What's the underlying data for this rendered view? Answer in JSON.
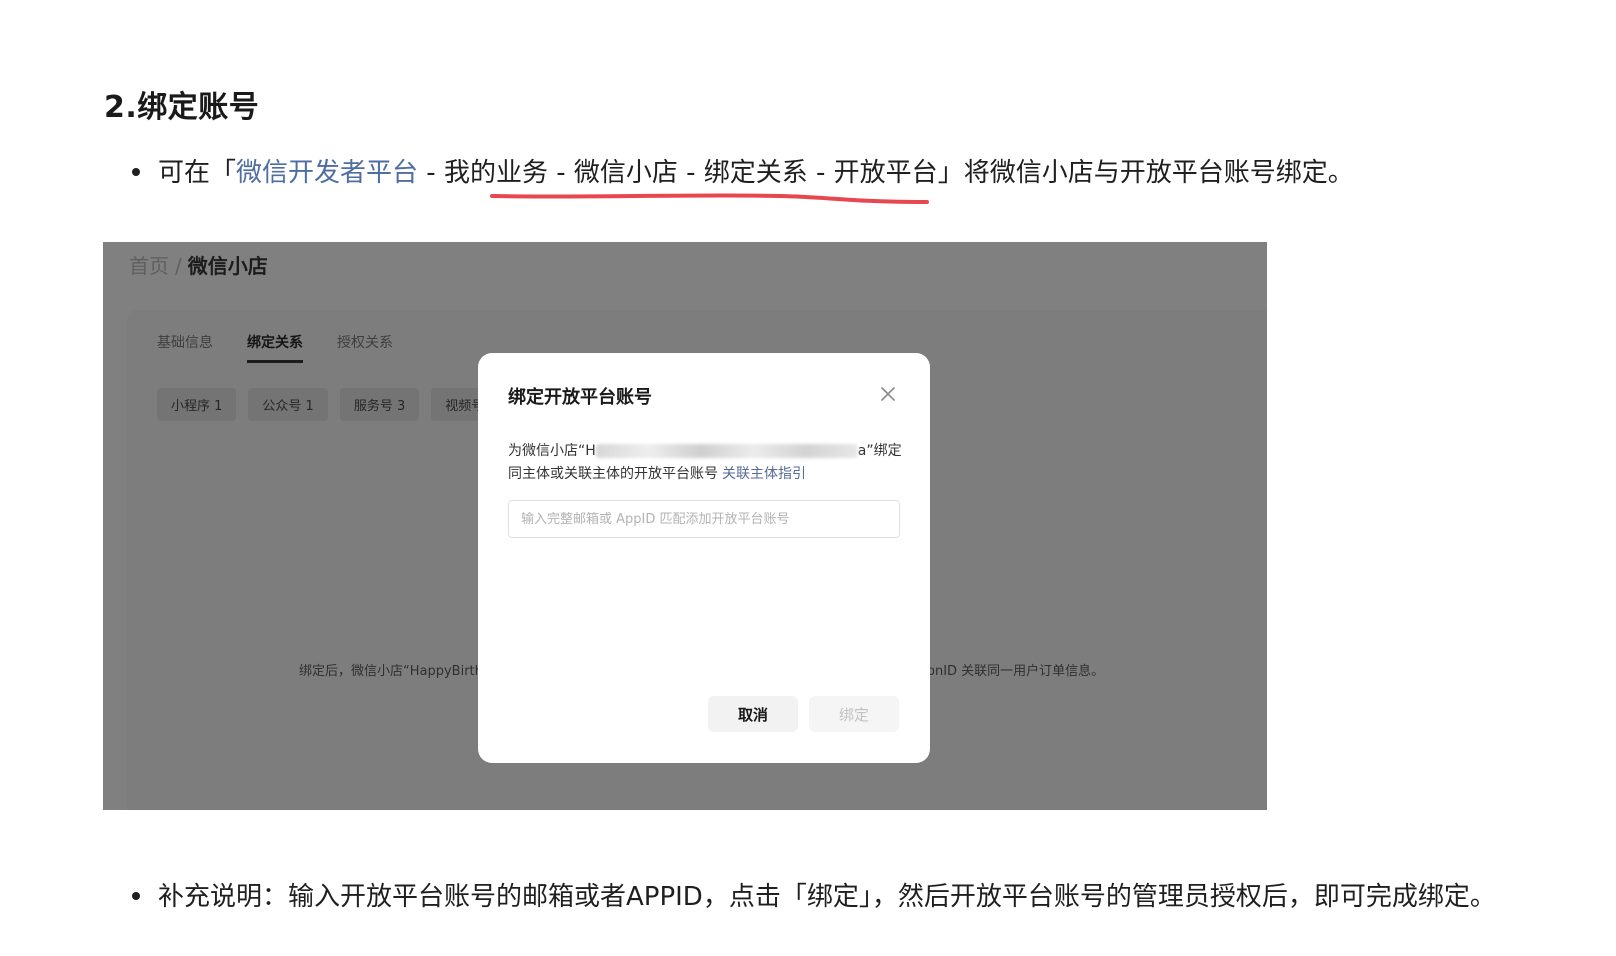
{
  "section": {
    "heading": "2.绑定账号"
  },
  "bullet1": {
    "prefix": "可在「",
    "link": "微信开发者平台",
    "path": " - 我的业务 - 微信小店 - 绑定关系 - 开放平台",
    "suffix": "」将微信小店与开放平台账号绑定。"
  },
  "screenshot": {
    "breadcrumb": {
      "home": "首页",
      "separator": "/",
      "current": "微信小店"
    },
    "tabs": [
      "基础信息",
      "绑定关系",
      "授权关系"
    ],
    "chips": [
      "小程序 1",
      "公众号 1",
      "服务号 3",
      "视频号"
    ],
    "note_left": "绑定后，微信小店“HappyBirth",
    "note_right": "onID 关联同一用户订单信息。",
    "modal": {
      "title": "绑定开放平台账号",
      "desc_line1_prefix": "为微信小店“H",
      "desc_line1_suffix": "a”绑定",
      "desc_line2": "同主体或关联主体的开放平台账号",
      "guide_link": "关联主体指引",
      "input_placeholder": "输入完整邮箱或 AppID 匹配添加开放平台账号",
      "cancel": "取消",
      "bind": "绑定"
    }
  },
  "bullet2": {
    "text": "补充说明：输入开放平台账号的邮箱或者APPID，点击「绑定」，然后开放平台账号的管理员授权后，即可完成绑定。"
  },
  "colors": {
    "link": "#4e6ea3",
    "annotation": "#e8474f",
    "overlay": "#808080"
  }
}
